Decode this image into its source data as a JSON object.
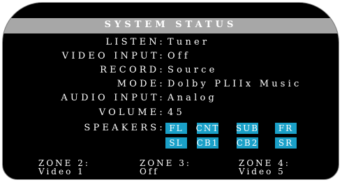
{
  "title": "SYSTEM STATUS",
  "status": {
    "listen": {
      "label": "LISTEN:",
      "value": "Tuner"
    },
    "video_input": {
      "label": "VIDEO INPUT:",
      "value": "Off"
    },
    "record": {
      "label": "RECORD:",
      "value": "Source"
    },
    "mode": {
      "label": "MODE:",
      "value": "Dolby PLIIx Music"
    },
    "audio_input": {
      "label": "AUDIO INPUT:",
      "value": "Analog"
    },
    "volume": {
      "label": "VOLUME:",
      "value": "45"
    },
    "speakers_label": "SPEAKERS:"
  },
  "speakers": [
    "FL",
    "CNT",
    "SUB",
    "FR",
    "SL",
    "CB1",
    "CB2",
    "SR"
  ],
  "zones": [
    {
      "label": "ZONE 2:",
      "value": "Video 1"
    },
    {
      "label": "ZONE 3:",
      "value": "Off"
    },
    {
      "label": "ZONE 4:",
      "value": "Video 5"
    }
  ],
  "colors": {
    "screen": "#000000",
    "title_strip": "#a7a7a7",
    "speaker_active": "#1aa0c8"
  }
}
